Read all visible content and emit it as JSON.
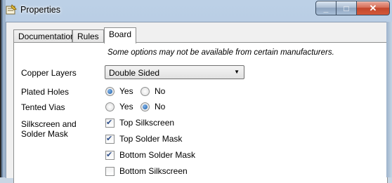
{
  "window": {
    "title": "Properties",
    "close_glyph": "✕",
    "min_glyph": "_",
    "max_glyph": "□"
  },
  "tabs": [
    {
      "label": "Documentation",
      "active": false
    },
    {
      "label": "Rules",
      "active": false
    },
    {
      "label": "Board",
      "active": true
    }
  ],
  "board": {
    "note": "Some options may not be available from certain manufacturers.",
    "copper_layers": {
      "label": "Copper Layers",
      "value": "Double Sided"
    },
    "plated_holes": {
      "label": "Plated Holes",
      "yes": "Yes",
      "no": "No",
      "selected": "Yes"
    },
    "tented_vias": {
      "label": "Tented Vias",
      "yes": "Yes",
      "no": "No",
      "selected": "No"
    },
    "silkscreen": {
      "label_line1": "Silkscreen and",
      "label_line2": "Solder Mask",
      "options": [
        {
          "label": "Top Silkscreen",
          "checked": true
        },
        {
          "label": "Top Solder Mask",
          "checked": true
        },
        {
          "label": "Bottom Solder Mask",
          "checked": true
        },
        {
          "label": "Bottom Silkscreen",
          "checked": false
        }
      ]
    }
  }
}
